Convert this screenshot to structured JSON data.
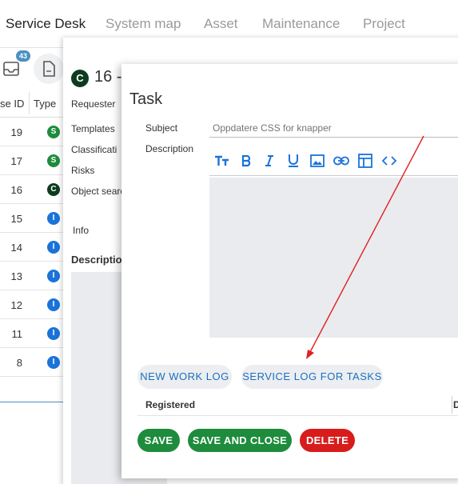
{
  "topnav": {
    "items": [
      {
        "label": "Service Desk",
        "active": true
      },
      {
        "label": "System map"
      },
      {
        "label": "Asset"
      },
      {
        "label": "Maintenance"
      },
      {
        "label": "Project"
      }
    ]
  },
  "list": {
    "badge_count": "43",
    "headers": {
      "id": "se ID",
      "type": "Type"
    },
    "rows": [
      {
        "id": "19",
        "type": "S",
        "color": "#1e8c3c"
      },
      {
        "id": "17",
        "type": "S",
        "color": "#1e8c3c"
      },
      {
        "id": "16",
        "type": "C",
        "color": "#0d3b1e"
      },
      {
        "id": "15",
        "type": "I",
        "color": "#1a73d9"
      },
      {
        "id": "14",
        "type": "I",
        "color": "#1a73d9"
      },
      {
        "id": "13",
        "type": "I",
        "color": "#1a73d9"
      },
      {
        "id": "12",
        "type": "I",
        "color": "#1a73d9"
      },
      {
        "id": "11",
        "type": "I",
        "color": "#1a73d9"
      },
      {
        "id": "8",
        "type": "I",
        "color": "#1a73d9"
      }
    ]
  },
  "ticket": {
    "type_letter": "C",
    "title": "16 -",
    "labels": {
      "requester": "Requester",
      "templates": "Templates",
      "classification": "Classificati",
      "risks": "Risks",
      "object_search": "Object searc",
      "info": "Info",
      "description": "Descriptio"
    }
  },
  "task": {
    "title": "Task",
    "subject_label": "Subject",
    "subject_placeholder": "Oppdatere CSS for knapper",
    "description_label": "Description",
    "toolbar_icons": [
      "text-size-icon",
      "bold-icon",
      "italic-icon",
      "underline-icon",
      "image-icon",
      "link-icon",
      "table-icon",
      "code-icon"
    ],
    "new_work_log": "NEW WORK LOG",
    "service_log": "SERVICE LOG FOR TASKS",
    "registered_label": "Registered",
    "next_col_label": "D",
    "save": "SAVE",
    "save_close": "SAVE AND CLOSE",
    "delete": "DELETE"
  },
  "colors": {
    "accent_blue": "#1a73d9",
    "green": "#1e8c3c",
    "red": "#d81c1c",
    "annotation_arrow": "#e02020"
  }
}
